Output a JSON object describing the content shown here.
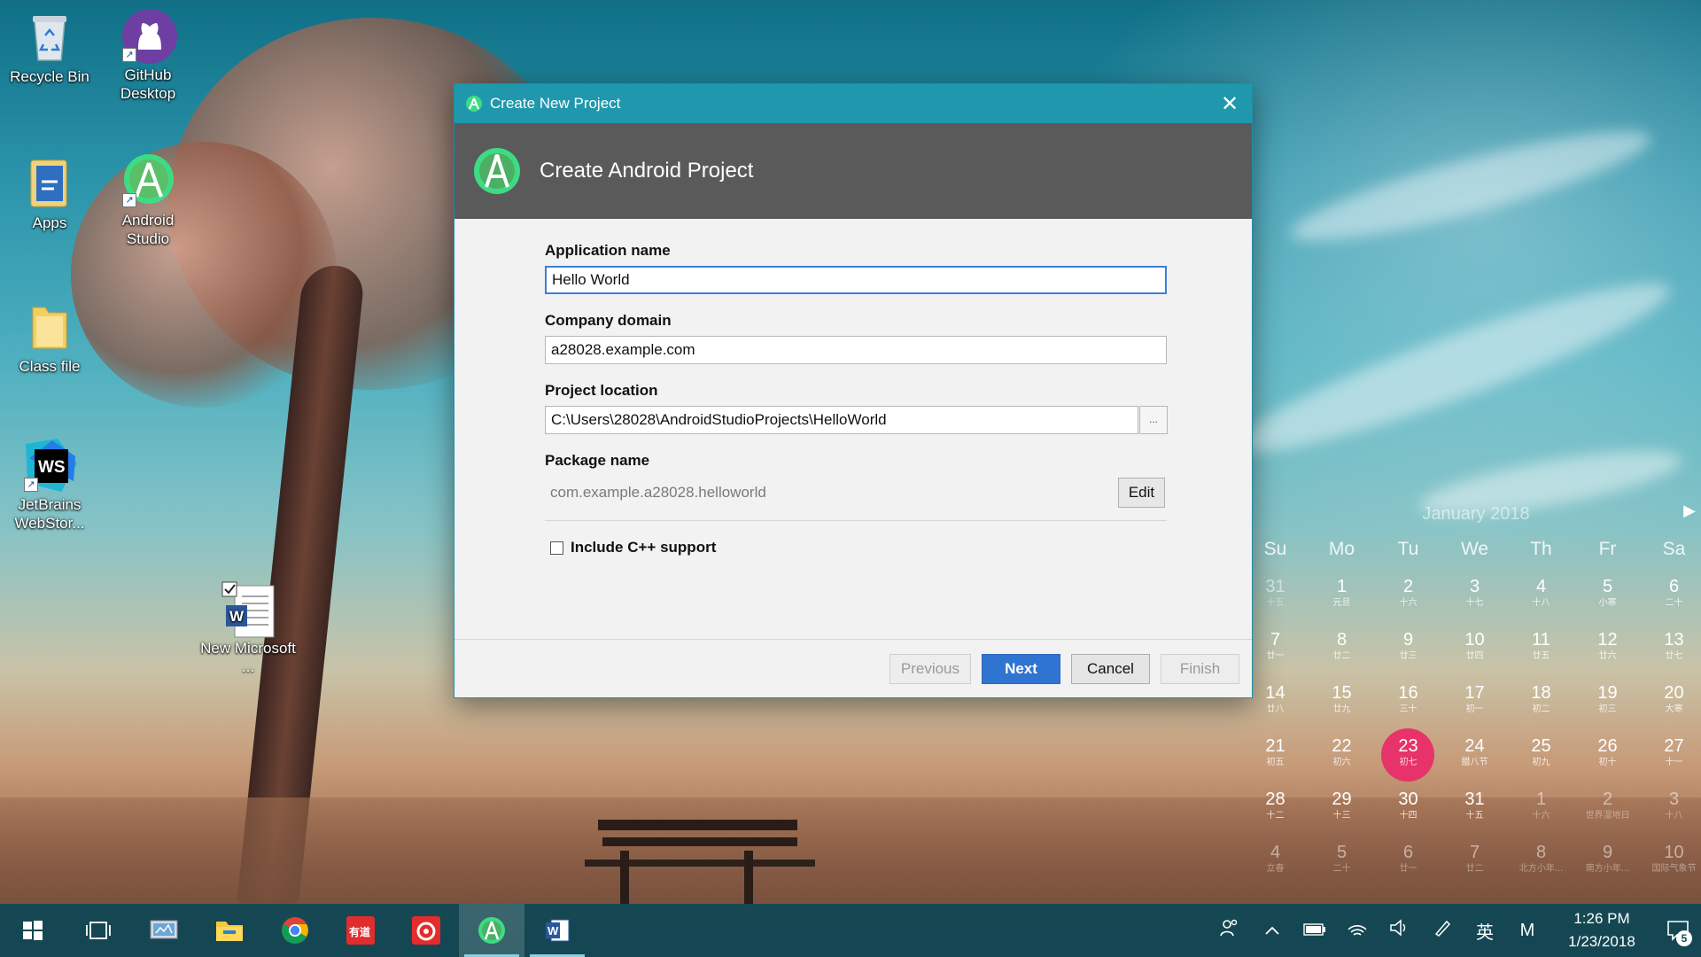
{
  "desktop": {
    "icons": [
      {
        "label": "Recycle Bin"
      },
      {
        "label": "GitHub Desktop"
      },
      {
        "label": "Apps"
      },
      {
        "label": "Android Studio"
      },
      {
        "label": "Class file"
      },
      {
        "label": "JetBrains WebStor..."
      },
      {
        "label": "New Microsoft ..."
      }
    ]
  },
  "dialog": {
    "window_title": "Create New Project",
    "header_title": "Create Android Project",
    "fields": {
      "app_name_label": "Application name",
      "app_name_value": "Hello World",
      "company_domain_label": "Company domain",
      "company_domain_value": "a28028.example.com",
      "project_location_label": "Project location",
      "project_location_value": "C:\\Users\\28028\\AndroidStudioProjects\\HelloWorld",
      "browse_label": "...",
      "package_name_label": "Package name",
      "package_name_value": "com.example.a28028.helloworld",
      "edit_label": "Edit",
      "cpp_support_label": "Include C++ support",
      "cpp_support_checked": false
    },
    "buttons": {
      "previous": "Previous",
      "next": "Next",
      "cancel": "Cancel",
      "finish": "Finish"
    }
  },
  "calendar": {
    "title": "January 2018",
    "weekdays": [
      "Su",
      "Mo",
      "Tu",
      "We",
      "Th",
      "Fr",
      "Sa"
    ],
    "weeks": [
      [
        {
          "d": "31",
          "l": "十五",
          "dim": true
        },
        {
          "d": "1",
          "l": "元旦"
        },
        {
          "d": "2",
          "l": "十六"
        },
        {
          "d": "3",
          "l": "十七"
        },
        {
          "d": "4",
          "l": "十八"
        },
        {
          "d": "5",
          "l": "小寒"
        },
        {
          "d": "6",
          "l": "二十"
        }
      ],
      [
        {
          "d": "7",
          "l": "廿一"
        },
        {
          "d": "8",
          "l": "廿二"
        },
        {
          "d": "9",
          "l": "廿三"
        },
        {
          "d": "10",
          "l": "廿四"
        },
        {
          "d": "11",
          "l": "廿五"
        },
        {
          "d": "12",
          "l": "廿六"
        },
        {
          "d": "13",
          "l": "廿七"
        }
      ],
      [
        {
          "d": "14",
          "l": "廿八"
        },
        {
          "d": "15",
          "l": "廿九"
        },
        {
          "d": "16",
          "l": "三十"
        },
        {
          "d": "17",
          "l": "初一"
        },
        {
          "d": "18",
          "l": "初二"
        },
        {
          "d": "19",
          "l": "初三"
        },
        {
          "d": "20",
          "l": "大寒"
        }
      ],
      [
        {
          "d": "21",
          "l": "初五"
        },
        {
          "d": "22",
          "l": "初六"
        },
        {
          "d": "23",
          "l": "初七",
          "today": true
        },
        {
          "d": "24",
          "l": "腊八节"
        },
        {
          "d": "25",
          "l": "初九"
        },
        {
          "d": "26",
          "l": "初十"
        },
        {
          "d": "27",
          "l": "十一"
        }
      ],
      [
        {
          "d": "28",
          "l": "十二"
        },
        {
          "d": "29",
          "l": "十三"
        },
        {
          "d": "30",
          "l": "十四"
        },
        {
          "d": "31",
          "l": "十五"
        },
        {
          "d": "1",
          "l": "十六",
          "dim": true
        },
        {
          "d": "2",
          "l": "世界湿地日",
          "dim": true
        },
        {
          "d": "3",
          "l": "十八",
          "dim": true
        }
      ],
      [
        {
          "d": "4",
          "l": "立春",
          "dim": true
        },
        {
          "d": "5",
          "l": "二十",
          "dim": true
        },
        {
          "d": "6",
          "l": "廿一",
          "dim": true
        },
        {
          "d": "7",
          "l": "廿二",
          "dim": true
        },
        {
          "d": "8",
          "l": "北方小年...",
          "dim": true
        },
        {
          "d": "9",
          "l": "南方小年...",
          "dim": true
        },
        {
          "d": "10",
          "l": "国际气象节",
          "dim": true
        }
      ]
    ]
  },
  "taskbar": {
    "apps": [
      {
        "icon": "windows-start-icon"
      },
      {
        "icon": "task-view-icon"
      },
      {
        "icon": "control-panel-icon"
      },
      {
        "icon": "file-explorer-icon"
      },
      {
        "icon": "chrome-icon"
      },
      {
        "icon": "youdao-icon",
        "text": "有道"
      },
      {
        "icon": "netease-music-icon"
      },
      {
        "icon": "android-studio-icon",
        "active": true
      },
      {
        "icon": "word-icon",
        "open": true
      }
    ],
    "tray": {
      "ime_label": "英",
      "ime_mode": "M",
      "time": "1:26 PM",
      "date": "1/23/2018",
      "notification_count": "5"
    }
  },
  "colors": {
    "titlebar": "#1f98ad",
    "header_band": "#5a5a5a",
    "primary_button": "#2f74d0",
    "today_highlight": "#e8336a",
    "android_green": "#3ddc84"
  }
}
